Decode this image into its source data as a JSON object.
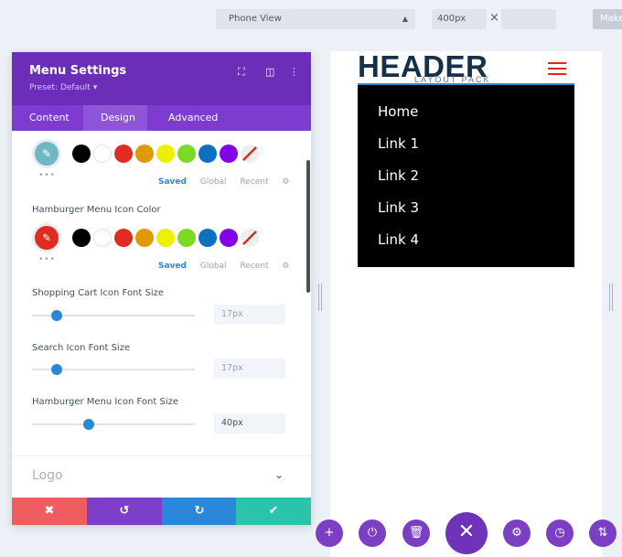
{
  "toolbar": {
    "view_select": "Phone View",
    "width_value": "400px",
    "make_label": "Make"
  },
  "panel": {
    "title": "Menu Settings",
    "preset": "Preset: Default ▾",
    "tabs": [
      {
        "label": "Content"
      },
      {
        "label": "Design"
      },
      {
        "label": "Advanced"
      }
    ],
    "active_tab": "Design",
    "palette1": {
      "picker_color": "#6fb7c2",
      "chips": [
        "Saved",
        "Global",
        "Recent"
      ]
    },
    "hamburger_color": {
      "label": "Hamburger Menu Icon Color",
      "picker_color": "#e02b20",
      "chips": [
        "Saved",
        "Global",
        "Recent"
      ]
    },
    "swatches": [
      "#000000",
      "#ffffff",
      "#e02b20",
      "#e09900",
      "#edf000",
      "#7cda24",
      "#0c71c3",
      "#8300e9"
    ],
    "cart_size": {
      "label": "Shopping Cart Icon Font Size",
      "value": "17px",
      "fraction": 0.15
    },
    "search_size": {
      "label": "Search Icon Font Size",
      "value": "17px",
      "fraction": 0.15
    },
    "hamburger_size": {
      "label": "Hamburger Menu Icon Font Size",
      "value": "40px",
      "fraction": 0.35
    },
    "section_logo": "Logo"
  },
  "preview": {
    "logo_main": "HEADER",
    "logo_sub": "LAYOUT PACK",
    "menu_items": [
      "Home",
      "Link 1",
      "Link 2",
      "Link 3",
      "Link 4"
    ]
  }
}
